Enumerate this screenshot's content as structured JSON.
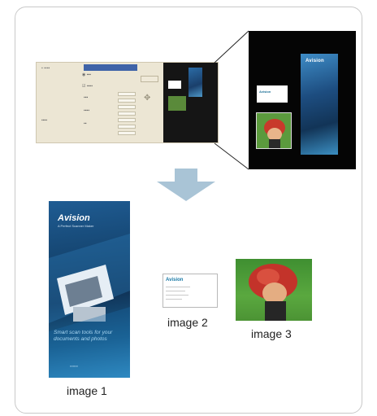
{
  "captions": {
    "image1": "image 1",
    "image2": "image 2",
    "image3": "image 3"
  },
  "brochure": {
    "brand": "Avision",
    "tagline": "A Perfect Scanner Maker",
    "slogan": "Smart scan tools for your documents and photos"
  },
  "business_card": {
    "brand": "Avision"
  },
  "preview": {
    "brand": "Avision"
  },
  "colors": {
    "arrow": "#a9c4d6",
    "brochure_dark": "#10355a",
    "brochure_light": "#3a9ad0",
    "photo_green": "#5aa83f",
    "software_bg": "#ece6d4",
    "software_select": "#3f63a8"
  }
}
